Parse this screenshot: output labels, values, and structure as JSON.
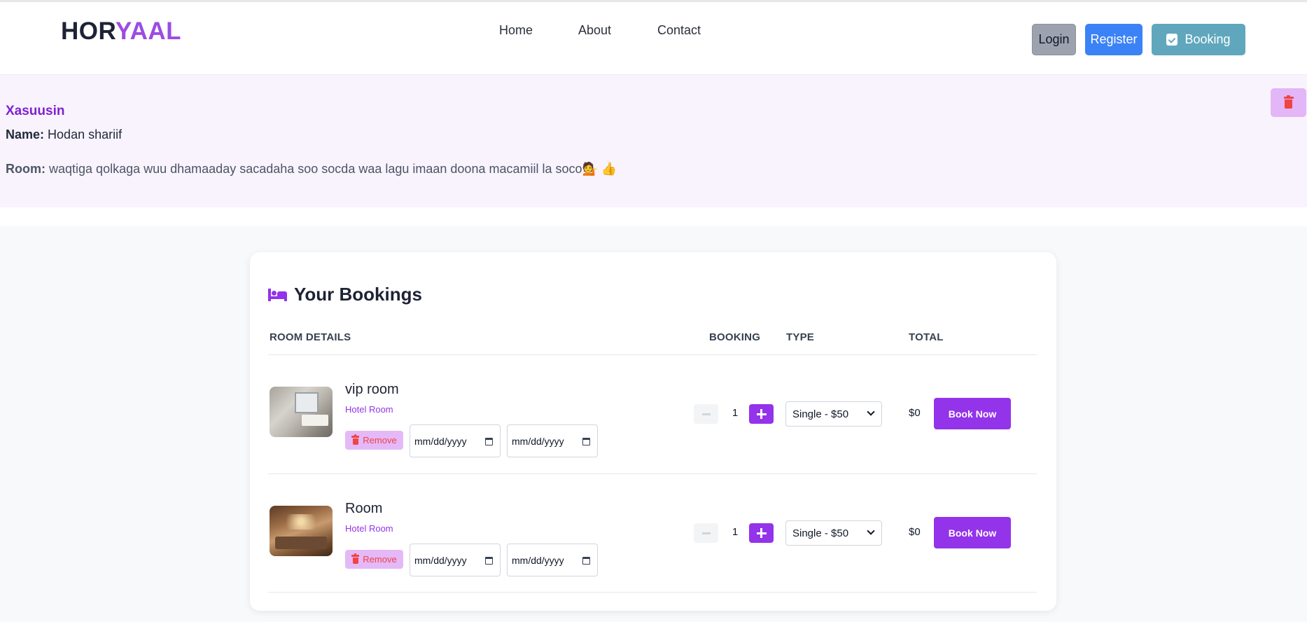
{
  "header": {
    "logo_part1": "HOR",
    "logo_part2": "YAAL",
    "nav": [
      "Home",
      "About",
      "Contact"
    ],
    "login_label": "Login",
    "register_label": "Register",
    "booking_label": "Booking"
  },
  "memo": {
    "title": "Xasuusin",
    "name_label": "Name:",
    "name_value": "Hodan shariif",
    "room_label": "Room:",
    "room_value": "waqtiga qolkaga wuu dhamaaday sacadaha soo socda waa lagu imaan doona macamiil la soco💁 👍"
  },
  "bookings": {
    "title": "Your Bookings",
    "columns": [
      "ROOM DETAILS",
      "BOOKING",
      "TYPE",
      "TOTAL"
    ],
    "rows": [
      {
        "name": "vip room",
        "subtitle": "Hotel Room",
        "remove_label": "Remove",
        "date_placeholder": "mm/dd/yyyy",
        "quantity": "1",
        "type": "Single - $50",
        "total": "$0",
        "book_label": "Book Now"
      },
      {
        "name": "Room",
        "subtitle": "Hotel Room",
        "remove_label": "Remove",
        "date_placeholder": "mm/dd/yyyy",
        "quantity": "1",
        "type": "Single - $50",
        "total": "$0",
        "book_label": "Book Now"
      }
    ]
  },
  "colors": {
    "brand_purple": "#9333ea",
    "logo_dark": "#1e2235",
    "logo_accent": "#9b4de0",
    "memo_bg": "#f9f3fe",
    "danger": "#ef4444"
  },
  "icons": {
    "booking_button": "calendar-check-icon",
    "memo_delete": "trash-icon",
    "card_title": "bed-icon",
    "remove": "trash-icon",
    "date_field": "calendar-icon",
    "qty_minus": "minus-icon",
    "qty_plus": "plus-icon",
    "select": "chevron-down-icon"
  }
}
